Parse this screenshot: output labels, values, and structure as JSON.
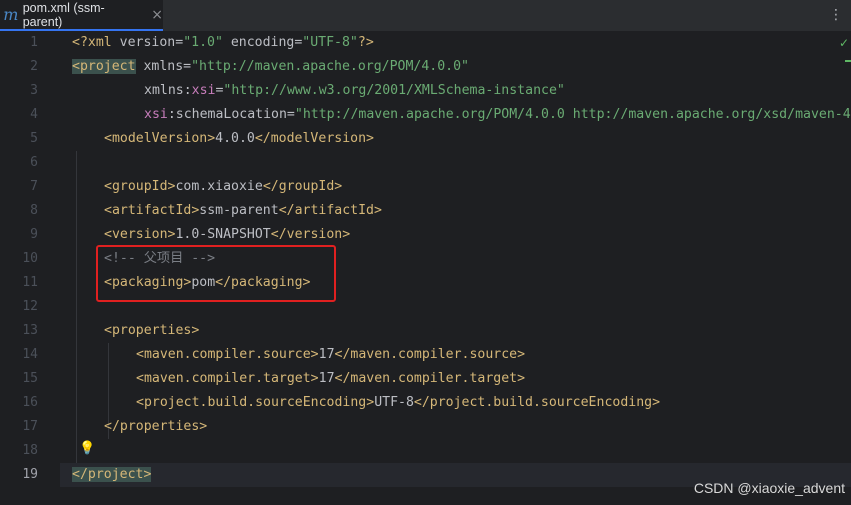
{
  "tab": {
    "icon": "maven-icon",
    "icon_glyph": "m",
    "label": "pom.xml (ssm-parent)",
    "close": "×"
  },
  "toolbar": {
    "more": "⋮"
  },
  "gutter": {
    "line_numbers": [
      "1",
      "2",
      "3",
      "4",
      "5",
      "6",
      "7",
      "8",
      "9",
      "10",
      "11",
      "12",
      "13",
      "14",
      "15",
      "16",
      "17",
      "18",
      "19"
    ],
    "current_line": "19"
  },
  "code": {
    "l1_open": "<?",
    "l1_tag": "xml",
    "l1_a1": " version=",
    "l1_v1": "\"1.0\"",
    "l1_a2": " encoding=",
    "l1_v2": "\"UTF-8\"",
    "l1_close": "?>",
    "l2_lt": "<",
    "l2_tag": "project",
    "l2_attr": " xmlns=",
    "l2_val": "\"http://maven.apache.org/POM/4.0.0\"",
    "l3_a": "xmlns:",
    "l3_ns": "xsi",
    "l3_eq": "=",
    "l3_val": "\"http://www.w3.org/2001/XMLSchema-instance\"",
    "l4_ns": "xsi",
    "l4_a": ":schemaLocation=",
    "l4_val": "\"http://maven.apache.org/POM/4.0.0 http://maven.apache.org/xsd/maven-4",
    "l5_o": "<modelVersion>",
    "l5_t": "4.0.0",
    "l5_c": "</modelVersion>",
    "l7_o": "<groupId>",
    "l7_t": "com.xiaoxie",
    "l7_c": "</groupId>",
    "l8_o": "<artifactId>",
    "l8_t": "ssm-parent",
    "l8_c": "</artifactId>",
    "l9_o": "<version>",
    "l9_t": "1.0-SNAPSHOT",
    "l9_c": "</version>",
    "l10_comment": "<!-- 父项目 -->",
    "l11_o": "<packaging>",
    "l11_t": "pom",
    "l11_c": "</packaging>",
    "l13_o": "<properties>",
    "l14_o": "<maven.compiler.source>",
    "l14_t": "17",
    "l14_c": "</maven.compiler.source>",
    "l15_o": "<maven.compiler.target>",
    "l15_t": "17",
    "l15_c": "</maven.compiler.target>",
    "l16_o": "<project.build.sourceEncoding>",
    "l16_t": "UTF-8",
    "l16_c": "</project.build.sourceEncoding>",
    "l17_c": "</properties>",
    "l19_lt": "<",
    "l19_tag": "/project",
    "l19_gt": ">"
  },
  "indicators": {
    "check": "✓",
    "bulb": "💡"
  },
  "watermark": "CSDN @xiaoxie_advent"
}
